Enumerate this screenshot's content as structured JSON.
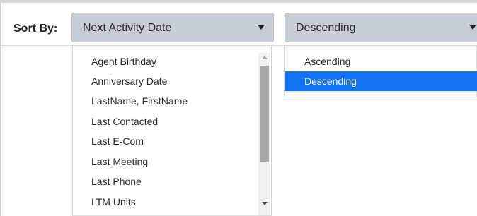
{
  "sort": {
    "label": "Sort By:",
    "field_selected": "Next Activity Date",
    "order_selected": "Descending"
  },
  "field_options": [
    "Agent Birthday",
    "Anniversary Date",
    "LastName, FirstName",
    "Last Contacted",
    "Last E-Com",
    "Last Meeting",
    "Last Phone",
    "LTM Units"
  ],
  "order_options": [
    "Ascending",
    "Descending"
  ],
  "colors": {
    "select_bg": "#c7cdd4",
    "highlight": "#1274f2"
  }
}
